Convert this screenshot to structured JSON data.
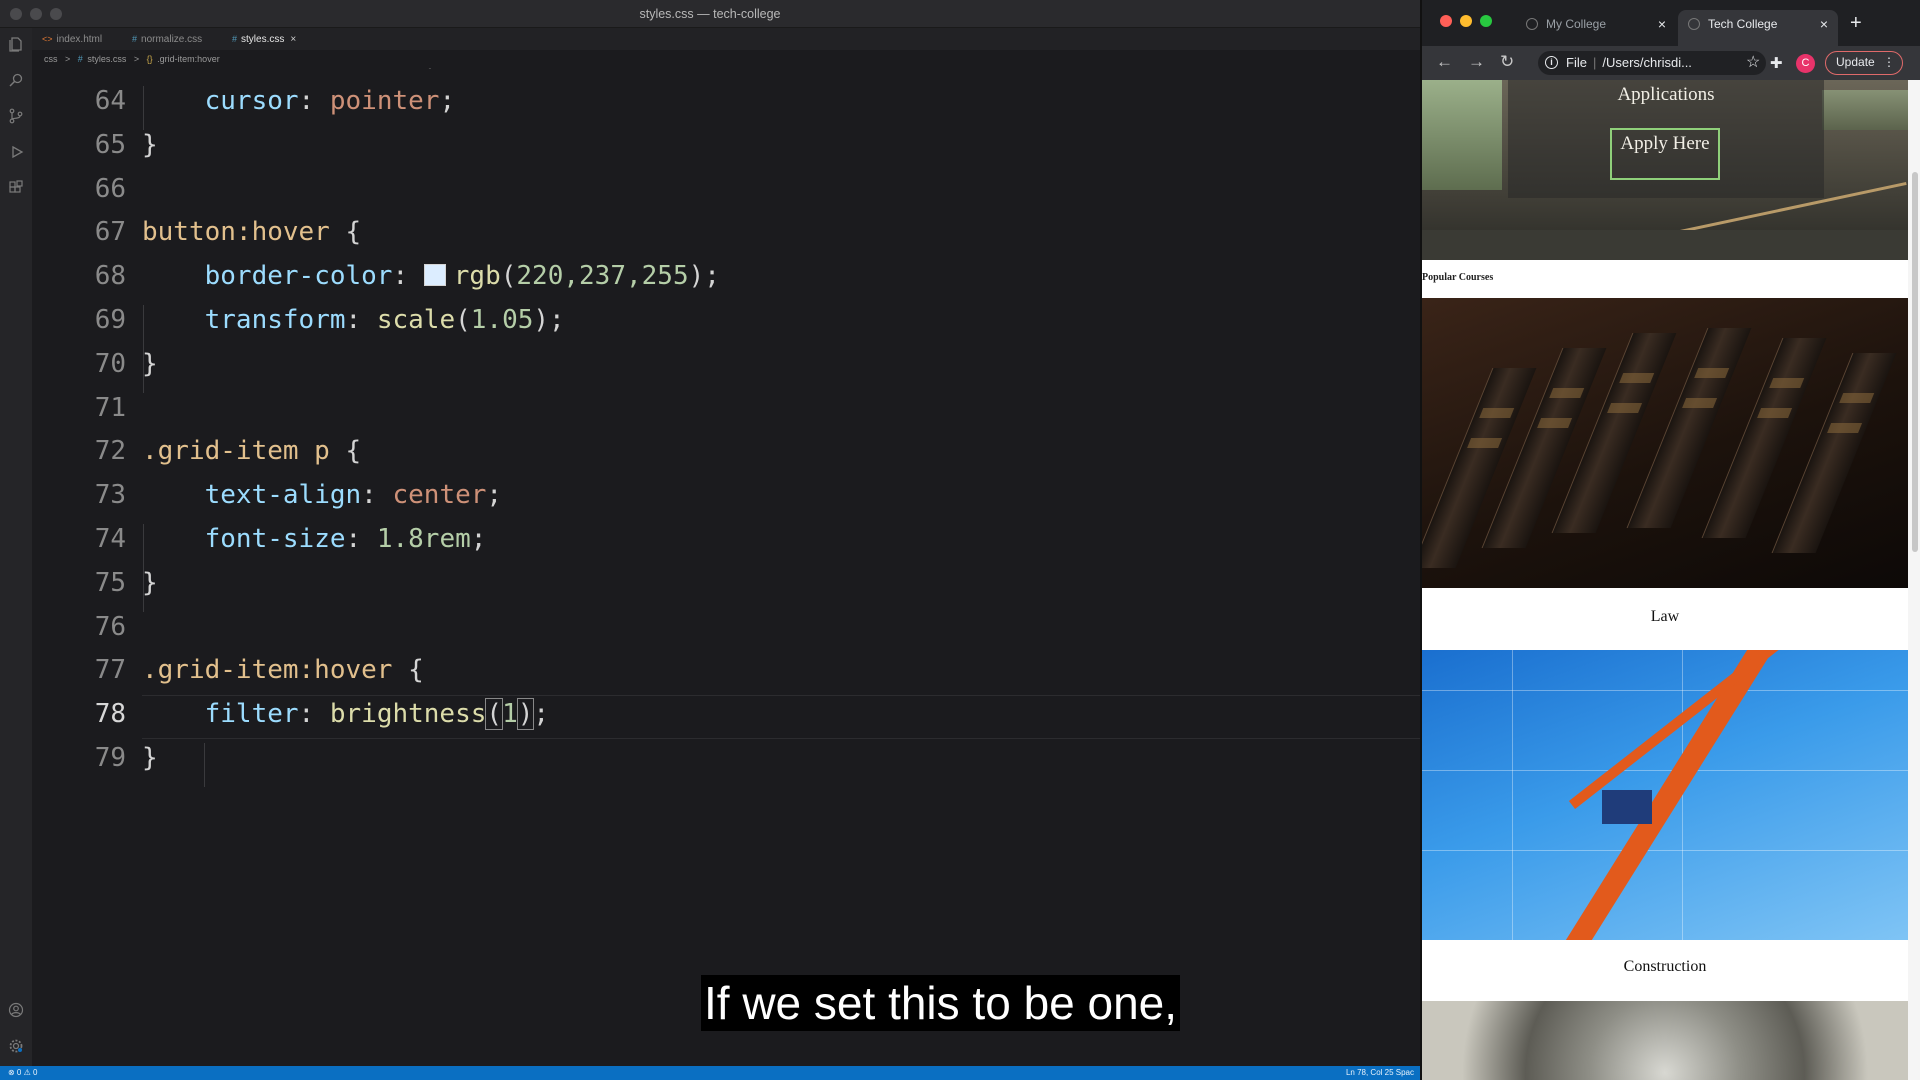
{
  "editor": {
    "window_title": "styles.css — tech-college",
    "tabs": [
      {
        "label": "index.html",
        "icon": "<>",
        "active": false
      },
      {
        "label": "normalize.css",
        "icon": "#",
        "active": false
      },
      {
        "label": "styles.css",
        "icon": "#",
        "active": true
      }
    ],
    "breadcrumb": [
      "css",
      ">",
      "#",
      "styles.css",
      ">",
      "{}",
      ".grid-item:hover"
    ],
    "current_line": 78,
    "line_numbers": [
      "64",
      "65",
      "66",
      "67",
      "68",
      "69",
      "70",
      "71",
      "72",
      "73",
      "74",
      "75",
      "76",
      "77",
      "78",
      "79"
    ],
    "status_left": "⊗ 0 ⚠ 0",
    "status_right": "Ln 78, Col 25   Spac"
  },
  "code": {
    "l64_prop": "cursor",
    "l64_val": "pointer",
    "l67_sel": "button:hover",
    "l68_prop": "border-color",
    "l68_fn": "rgb",
    "l68_args": "220,237,255",
    "l69_prop": "transform",
    "l69_fn": "scale",
    "l69_arg": "1.05",
    "l72_sel": ".grid-item p",
    "l73_prop": "text-align",
    "l73_val": "center",
    "l74_prop": "font-size",
    "l74_val": "1.8rem",
    "l77_sel": ".grid-item:hover",
    "l78_prop": "filter",
    "l78_fn": "brightness",
    "l78_arg": "1"
  },
  "subtitle": "If we set this to be one,",
  "browser": {
    "tabs": [
      {
        "label": "My College",
        "active": false
      },
      {
        "label": "Tech College",
        "active": true
      }
    ],
    "omnibox_scheme": "File",
    "omnibox_path": "/Users/chrisdi...",
    "avatar_letter": "C",
    "update_label": "Update",
    "page": {
      "hero_heading": "Applications",
      "apply_button": "Apply Here",
      "section_label": "Popular Courses",
      "courses": [
        "Law",
        "Construction"
      ]
    }
  },
  "colors": {
    "status_bar": "#0a6fc2",
    "selector": "#e2c08d",
    "property": "#9cdcfe",
    "value": "#ce9178",
    "number": "#b5cea8",
    "apply_border": "#8fd07a"
  }
}
